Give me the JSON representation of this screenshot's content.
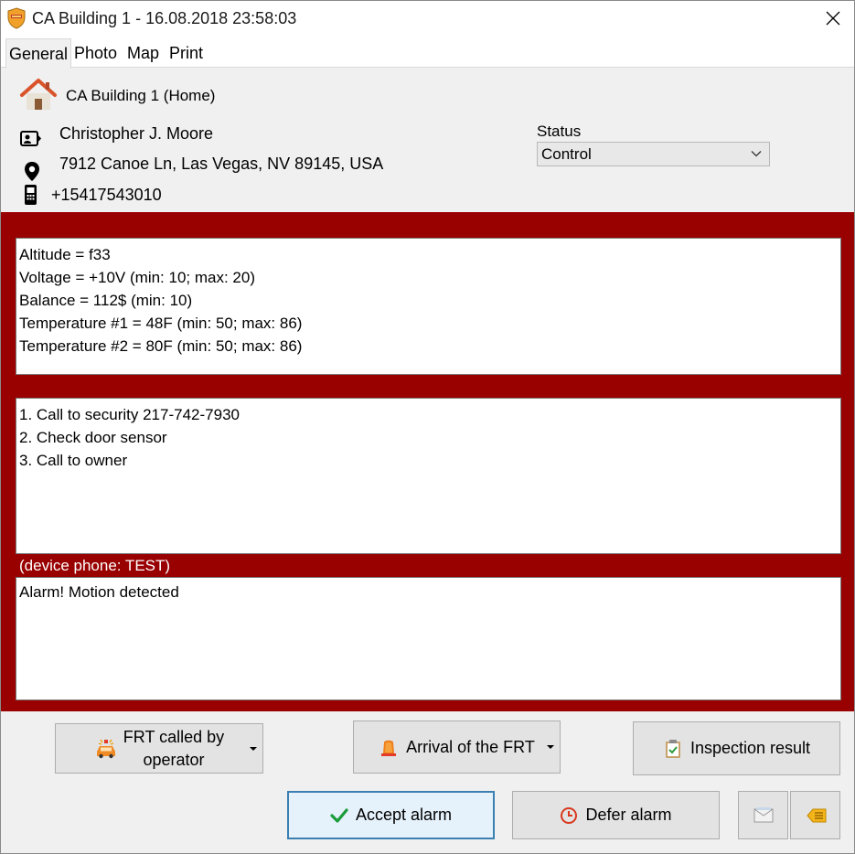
{
  "window": {
    "title": "CA Building 1 - 16.08.2018 23:58:03"
  },
  "tabs": [
    {
      "label": "General",
      "active": true
    },
    {
      "label": "Photo",
      "active": false
    },
    {
      "label": "Map",
      "active": false
    },
    {
      "label": "Print",
      "active": false
    }
  ],
  "object": {
    "name": "CA Building 1 (Home)",
    "owner": "Christopher J. Moore",
    "address": "7912 Canoe Ln, Las Vegas, NV 89145, USA",
    "phone": "+15417543010"
  },
  "status": {
    "label": "Status",
    "value": "Control"
  },
  "sensors": {
    "lines": [
      "Altitude = f33",
      "Voltage = +10V (min: 10; max: 20)",
      "Balance = 112$ (min: 10)",
      "Temperature #1 = 48F (min: 50; max: 86)",
      "Temperature #2 = 80F (min: 50; max: 86)"
    ]
  },
  "instructions": {
    "lines": [
      "1. Call to security 217-742-7930",
      "2. Check door sensor",
      "3. Call to owner"
    ]
  },
  "device_phone": "(device phone: TEST)",
  "alarm_message": "Alarm! Motion detected",
  "buttons": {
    "frt_called_line1": "FRT called by",
    "frt_called_line2": "operator",
    "arrival": "Arrival of the FRT",
    "inspection": "Inspection result",
    "accept": "Accept alarm",
    "defer": "Defer alarm"
  },
  "colors": {
    "alarm_background": "#990000",
    "accept_check": "#1a9c3a",
    "defer_clock": "#d9381e"
  },
  "icons": {
    "app": "shield-icon",
    "close": "close-icon",
    "house": "house-icon",
    "owner": "contact-card-icon",
    "address": "location-pin-icon",
    "phone": "mobile-phone-icon",
    "frt_called": "car-siren-icon",
    "arrival": "warning-light-icon",
    "inspection": "clipboard-check-icon",
    "accept": "checkmark-icon",
    "defer": "clock-icon",
    "mail": "envelope-icon",
    "forward": "forward-note-icon"
  }
}
